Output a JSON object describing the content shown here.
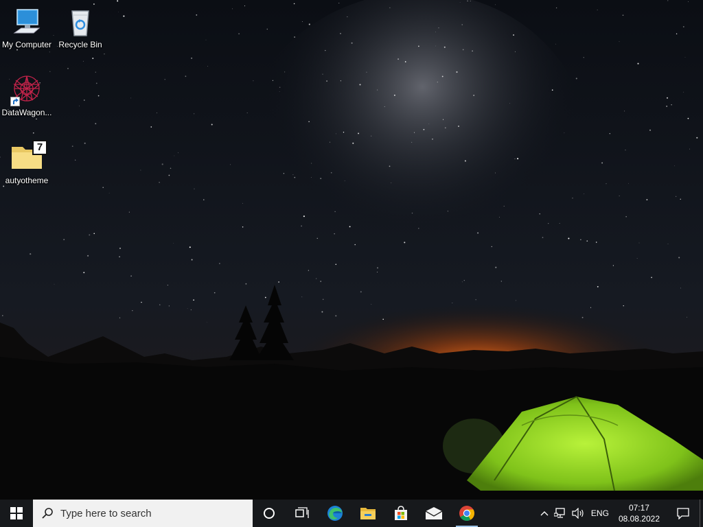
{
  "desktop": {
    "icons": [
      {
        "label": "My Computer",
        "icon": "computer-icon"
      },
      {
        "label": "Recycle Bin",
        "icon": "recycle-bin-icon"
      },
      {
        "label": "DataWagon...",
        "icon": "datawagon-icon"
      },
      {
        "label": "autyotheme",
        "icon": "folder-icon"
      }
    ],
    "folder_badge": "7"
  },
  "taskbar": {
    "start_icon": "windows-start-icon",
    "search_placeholder": "Type here to search",
    "pinned": [
      {
        "name": "cortana",
        "icon": "cortana-circle-icon"
      },
      {
        "name": "task-view",
        "icon": "task-view-icon"
      },
      {
        "name": "edge",
        "icon": "edge-icon"
      },
      {
        "name": "file-explorer",
        "icon": "folder-icon"
      },
      {
        "name": "store",
        "icon": "store-bag-icon"
      },
      {
        "name": "mail",
        "icon": "mail-icon"
      },
      {
        "name": "chrome",
        "icon": "chrome-icon"
      }
    ],
    "tray": {
      "language": "ENG",
      "time": "07:17",
      "date": "08.08.2022"
    }
  }
}
